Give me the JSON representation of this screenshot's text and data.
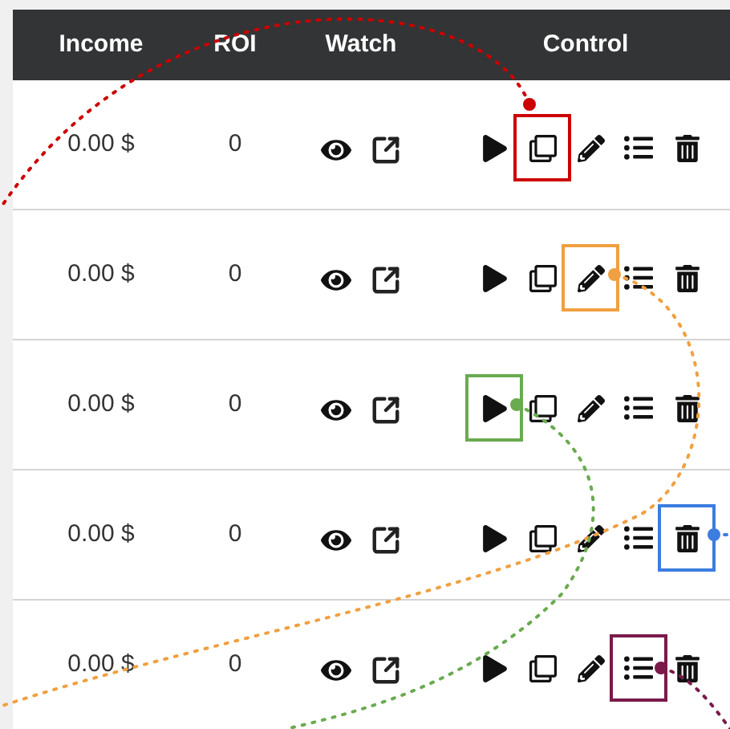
{
  "table": {
    "columns": [
      "Income",
      "ROI",
      "Watch",
      "Control"
    ],
    "rows": [
      {
        "income": "0.00 $",
        "roi": "0",
        "marked": {
          "kind": "copy",
          "color": "#cc0000"
        }
      },
      {
        "income": "0.00 $",
        "roi": "0",
        "marked": {
          "kind": "edit",
          "color": "#f0a040"
        }
      },
      {
        "income": "0.00 $",
        "roi": "0",
        "marked": {
          "kind": "play",
          "color": "#6aaa50"
        }
      },
      {
        "income": "0.00 $",
        "roi": "0",
        "marked": {
          "kind": "delete",
          "color": "#3b7de0"
        }
      },
      {
        "income": "0.00 $",
        "roi": "0",
        "marked": {
          "kind": "list",
          "color": "#7a1a4a"
        }
      }
    ]
  }
}
